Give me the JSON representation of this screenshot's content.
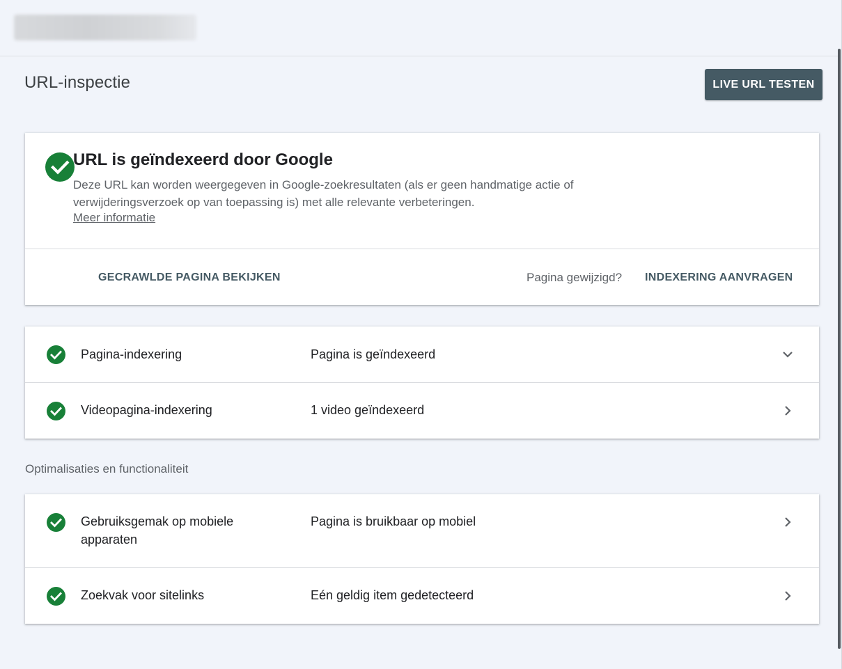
{
  "page": {
    "title": "URL-inspectie",
    "live_button": "LIVE URL TESTEN"
  },
  "status": {
    "heading": "URL is geïndexeerd door Google",
    "description": "Deze URL kan worden weergegeven in Google-zoekresultaten (als er geen handmatige actie of verwijderingsverzoek op van toepassing is) met alle relevante verbeteringen.",
    "more_link": "Meer informatie",
    "view_crawled": "GECRAWLDE PAGINA BEKIJKEN",
    "page_changed": "Pagina gewijzigd?",
    "request_indexing": "INDEXERING AANVRAGEN"
  },
  "indexing": {
    "rows": [
      {
        "label": "Pagina-indexering",
        "value": "Pagina is geïndexeerd",
        "chevron": "chevron-down-icon"
      },
      {
        "label": "Videopagina-indexering",
        "value": "1 video geïndexeerd",
        "chevron": "chevron-right-icon"
      }
    ]
  },
  "optimizations": {
    "section_label": "Optimalisaties en functionaliteit",
    "rows": [
      {
        "label": "Gebruiksgemak op mobiele apparaten",
        "value": "Pagina is bruikbaar op mobiel",
        "chevron": "chevron-right-icon"
      },
      {
        "label": "Zoekvak voor sitelinks",
        "value": "Eén geldig item gedetecteerd",
        "chevron": "chevron-right-icon"
      }
    ]
  },
  "colors": {
    "success": "#188038",
    "button_bg": "#455a64",
    "background": "#f1f4fa"
  }
}
